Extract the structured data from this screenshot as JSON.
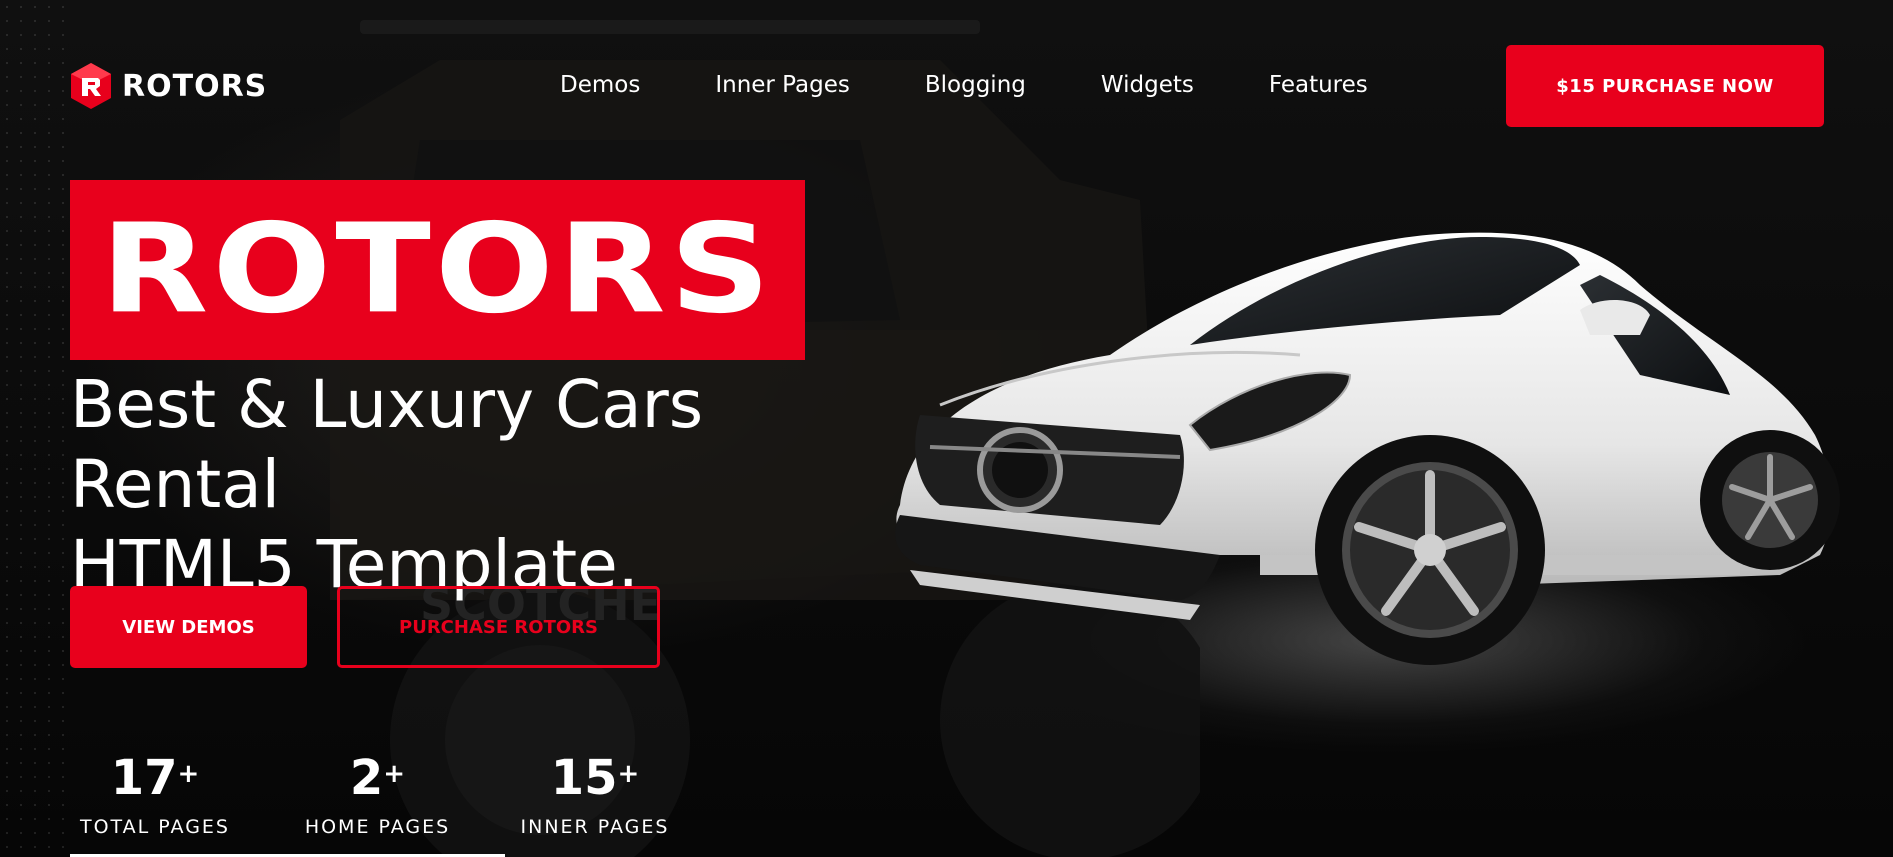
{
  "header": {
    "logo_text": "ROTORS",
    "nav": [
      {
        "label": "Demos"
      },
      {
        "label": "Inner Pages"
      },
      {
        "label": "Blogging"
      },
      {
        "label": "Widgets"
      },
      {
        "label": "Features"
      }
    ],
    "purchase_button": "$15 PURCHASE NOW"
  },
  "hero": {
    "title": "ROTORS",
    "subtitle_line1": "Best & Luxury Cars Rental",
    "subtitle_line2": "HTML5 Template.",
    "primary_button": "VIEW DEMOS",
    "secondary_button": "PURCHASE ROTORS"
  },
  "stats": [
    {
      "value": "17",
      "suffix": "+",
      "label": "TOTAL PAGES"
    },
    {
      "value": "2",
      "suffix": "+",
      "label": "HOME PAGES"
    },
    {
      "value": "15",
      "suffix": "+",
      "label": "INNER PAGES"
    }
  ],
  "colors": {
    "accent": "#e8001c",
    "background": "#0b0b0b",
    "text": "#ffffff"
  },
  "icons": {
    "logo": "rotors-hexagon-logo-icon"
  }
}
